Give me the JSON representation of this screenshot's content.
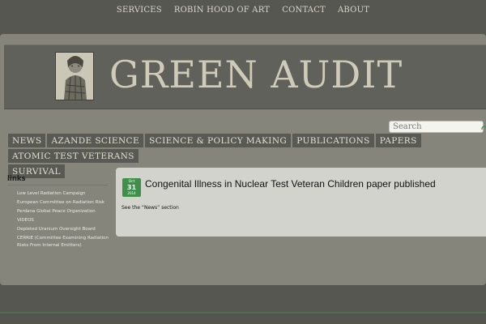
{
  "top_nav": {
    "items": [
      "SERVICES",
      "ROBIN HOOD OF ART",
      "CONTACT",
      "ABOUT"
    ]
  },
  "header": {
    "title": "GREEN AUDIT"
  },
  "search": {
    "placeholder": "Search"
  },
  "main_nav": {
    "items": [
      "NEWS",
      "AZANDE SCIENCE",
      "SCIENCE & POLICY MAKING",
      "PUBLICATIONS",
      "PAPERS",
      "ATOMIC TEST VETERANS",
      "SURVIVAL"
    ]
  },
  "sidebar": {
    "title": "links",
    "links": [
      "Low Level Radiation Campaign",
      "European Committee on Radiation Risk",
      "Perdana Global Peace Organization",
      "VIDEOS",
      "Depleted Uranium Oversight Board",
      "CERRIE (Committee Examining Radiation Risks From Internal Emitters)"
    ]
  },
  "post": {
    "date": {
      "month": "Oct",
      "day": "31",
      "year": "2014"
    },
    "title": "Congenital Illness in Nuclear Test Veteran Children paper published",
    "excerpt": "See the “News” section"
  },
  "colors": {
    "background": "#575752",
    "frame": "#85857c",
    "header_band": "#61615b",
    "nav_item": "#5a5a54",
    "date_badge": "#3f8f4a",
    "content_panel": "#d3d3ce"
  }
}
